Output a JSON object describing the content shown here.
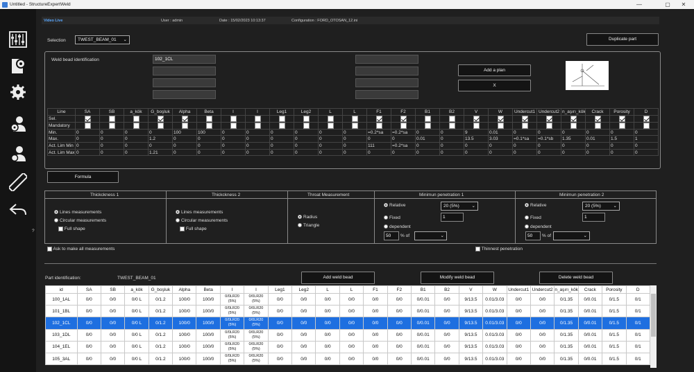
{
  "window": {
    "title": "Untitled - StructureExpertWeld",
    "minimize": "—",
    "maximize": "▢",
    "close": "✕"
  },
  "sidebar": {
    "icons": [
      "tool-cabinet-icon",
      "document-gear-icon",
      "gears-icon",
      "operator-settings-icon",
      "operator-tool-icon",
      "ruler-icon",
      "back-arrow-icon"
    ],
    "help": "?"
  },
  "topstrip": {
    "mode": "Video Live",
    "user": "User : admin",
    "date": "Date : 15/02/2023 10:13:37",
    "config": "Configuration : FORD_OTOSAN_12.ini"
  },
  "selection": {
    "label": "Selection",
    "value": "TWEST_BEAM_01",
    "duplicate": "Duplicate part"
  },
  "bead": {
    "label": "Weld bead identification",
    "fields": [
      "102_1CL",
      "",
      "",
      "",
      ""
    ],
    "right_fields": [
      "",
      "",
      "",
      "",
      ""
    ],
    "add_plan": "Add a plan",
    "x": "X"
  },
  "params": {
    "headers": [
      "Line",
      "SA",
      "SB",
      "a_kök",
      "G_boşluk",
      "Alpha",
      "Beta",
      "l",
      "l",
      "Leg1",
      "Leg2",
      "L",
      "L",
      "F1",
      "F2",
      "B1",
      "B2",
      "V",
      "W",
      "Undercut1",
      "Undercut2",
      "n_aşırı_kök",
      "Crack",
      "Porosity",
      "D"
    ],
    "sel_label": "Sel.",
    "sel": [
      1,
      0,
      0,
      1,
      1,
      0,
      0,
      0,
      0,
      0,
      0,
      0,
      1,
      1,
      0,
      0,
      1,
      1,
      1,
      1,
      1,
      1,
      1,
      1
    ],
    "mand_label": "Mandatory",
    "rows": [
      [
        "Min.",
        "0",
        "0",
        "0",
        "0",
        "100",
        "100",
        "0",
        "0",
        "0",
        "0",
        "0",
        "0",
        "=0.2*sa",
        "=0.2*sa",
        "0",
        "0",
        "9",
        "0.01",
        "0",
        "0",
        "0",
        "0",
        "0",
        "0"
      ],
      [
        "Max.",
        "0",
        "0",
        "0",
        "1.2",
        "0",
        "0",
        "0",
        "0",
        "0",
        "0",
        "0",
        "0",
        "0",
        "0",
        "0.01",
        "0",
        "13.5",
        "3.03",
        "=0.1*sa",
        "=0.1*sb",
        "1.35",
        "0.01",
        "1.5",
        "1"
      ],
      [
        "Act. Lim Min",
        "0",
        "0",
        "0",
        "0",
        "0",
        "0",
        "0",
        "0",
        "0",
        "0",
        "0",
        "0",
        "111",
        "=0.2*sa",
        "0",
        "0",
        "0",
        "0",
        "0",
        "0",
        "0",
        "0",
        "0",
        "0"
      ],
      [
        "Act. Lim Max",
        "0",
        "0",
        "0",
        "1.21",
        "0",
        "0",
        "0",
        "0",
        "0",
        "0",
        "0",
        "0",
        "0",
        "0",
        "0",
        "0",
        "0",
        "0",
        "0",
        "0",
        "0",
        "0",
        "0",
        "0"
      ]
    ],
    "formula": "Formula"
  },
  "measure": {
    "t1": {
      "title": "Thickckness 1",
      "lines": "Lines measurements",
      "circ": "Circular measurements",
      "full": "Full shape"
    },
    "t2": {
      "title": "Thickckness 2",
      "lines": "Lines measurements",
      "circ": "Circular measurements",
      "full": "Full shape"
    },
    "throat": {
      "title": "Throat Measurement",
      "radius": "Radius",
      "triangle": "Triangle"
    },
    "p1": {
      "title": "Minimun penetration 1",
      "relative": "Relative",
      "rel_val": "20 (5%)",
      "fixed": "Fixed",
      "fixed_val": "1",
      "dependent": "dependent",
      "pct": "50",
      "pct_of": "% of"
    },
    "p2": {
      "title": "Minimun penetration 2",
      "relative": "Relative",
      "rel_val": "20 (5%)",
      "fixed": "Fixed",
      "fixed_val": "1",
      "dependent": "dependent",
      "pct": "50",
      "pct_of": "% of"
    },
    "ask": "Ask to make all measurements",
    "thinnest": "Thinnest penetration"
  },
  "part": {
    "label": "Part identification:",
    "value": "TWEST_BEAM_01",
    "add": "Add weld bead",
    "modify": "Modify weld bead",
    "delete": "Delete weld bead"
  },
  "grid": {
    "headers": [
      "id",
      "SA",
      "SB",
      "a_kök",
      "G_boşluk",
      "Alpha",
      "Beta",
      "l",
      "l",
      "Leg1",
      "Leg2",
      "L",
      "L",
      "F1",
      "F2",
      "B1",
      "B2",
      "V",
      "W",
      "Undercut1",
      "Undercut2",
      "n_aşırı_kök",
      "Crack",
      "Porosity",
      "D"
    ],
    "rows": [
      [
        "100_1AL",
        "0/0",
        "0/0",
        "0/0 L",
        "0/1.2",
        "100/0",
        "100/0",
        "0/0LR20 (5%)",
        "0/0LR20 (5%)",
        "0/0",
        "0/0",
        "0/0",
        "0/0",
        "0/0",
        "0/0",
        "0/0.01",
        "0/0",
        "9/13.5",
        "0.01/3.03",
        "0/0",
        "0/0",
        "0/1.35",
        "0/0.01",
        "0/1.5",
        "0/1"
      ],
      [
        "101_1BL",
        "0/0",
        "0/0",
        "0/0 L",
        "0/1.2",
        "100/0",
        "100/0",
        "0/0LR20 (5%)",
        "0/0LR20 (5%)",
        "0/0",
        "0/0",
        "0/0",
        "0/0",
        "0/0",
        "0/0",
        "0/0.01",
        "0/0",
        "9/13.5",
        "0.01/3.03",
        "0/0",
        "0/0",
        "0/1.35",
        "0/0.01",
        "0/1.5",
        "0/1"
      ],
      [
        "102_1CL",
        "0/0",
        "0/0",
        "0/0 L",
        "0/1.2",
        "100/0",
        "100/0",
        "0/0LR20 (5%)",
        "0/0LR20 (5%)",
        "0/0",
        "0/0",
        "0/0",
        "0/0",
        "0/0",
        "0/0",
        "0/0.01",
        "0/0",
        "9/13.5",
        "0.01/3.03",
        "0/0",
        "0/0",
        "0/1.35",
        "0/0.01",
        "0/1.5",
        "0/1"
      ],
      [
        "103_1DL",
        "0/0",
        "0/0",
        "0/0 L",
        "0/1.2",
        "100/0",
        "100/0",
        "0/0LR20 (5%)",
        "0/0LR20 (5%)",
        "0/0",
        "0/0",
        "0/0",
        "0/0",
        "0/0",
        "0/0",
        "0/0.01",
        "0/0",
        "9/13.5",
        "0.01/3.03",
        "0/0",
        "0/0",
        "0/1.35",
        "0/0.01",
        "0/1.5",
        "0/1"
      ],
      [
        "104_1EL",
        "0/0",
        "0/0",
        "0/0 L",
        "0/1.2",
        "100/0",
        "100/0",
        "0/0LR20 (5%)",
        "0/0LR20 (5%)",
        "0/0",
        "0/0",
        "0/0",
        "0/0",
        "0/0",
        "0/0",
        "0/0.01",
        "0/0",
        "9/13.5",
        "0.01/3.03",
        "0/0",
        "0/0",
        "0/1.35",
        "0/0.01",
        "0/1.5",
        "0/1"
      ],
      [
        "105_3AL",
        "0/0",
        "0/0",
        "0/0 L",
        "0/1.2",
        "100/0",
        "100/0",
        "0/0LR20 (5%)",
        "0/0LR20 (5%)",
        "0/0",
        "0/0",
        "0/0",
        "0/0",
        "0/0",
        "0/0",
        "0/0.01",
        "0/0",
        "9/13.5",
        "0.01/3.03",
        "0/0",
        "0/0",
        "0/1.35",
        "0/0.01",
        "0/1.5",
        "0/1"
      ]
    ],
    "selected": 2
  }
}
